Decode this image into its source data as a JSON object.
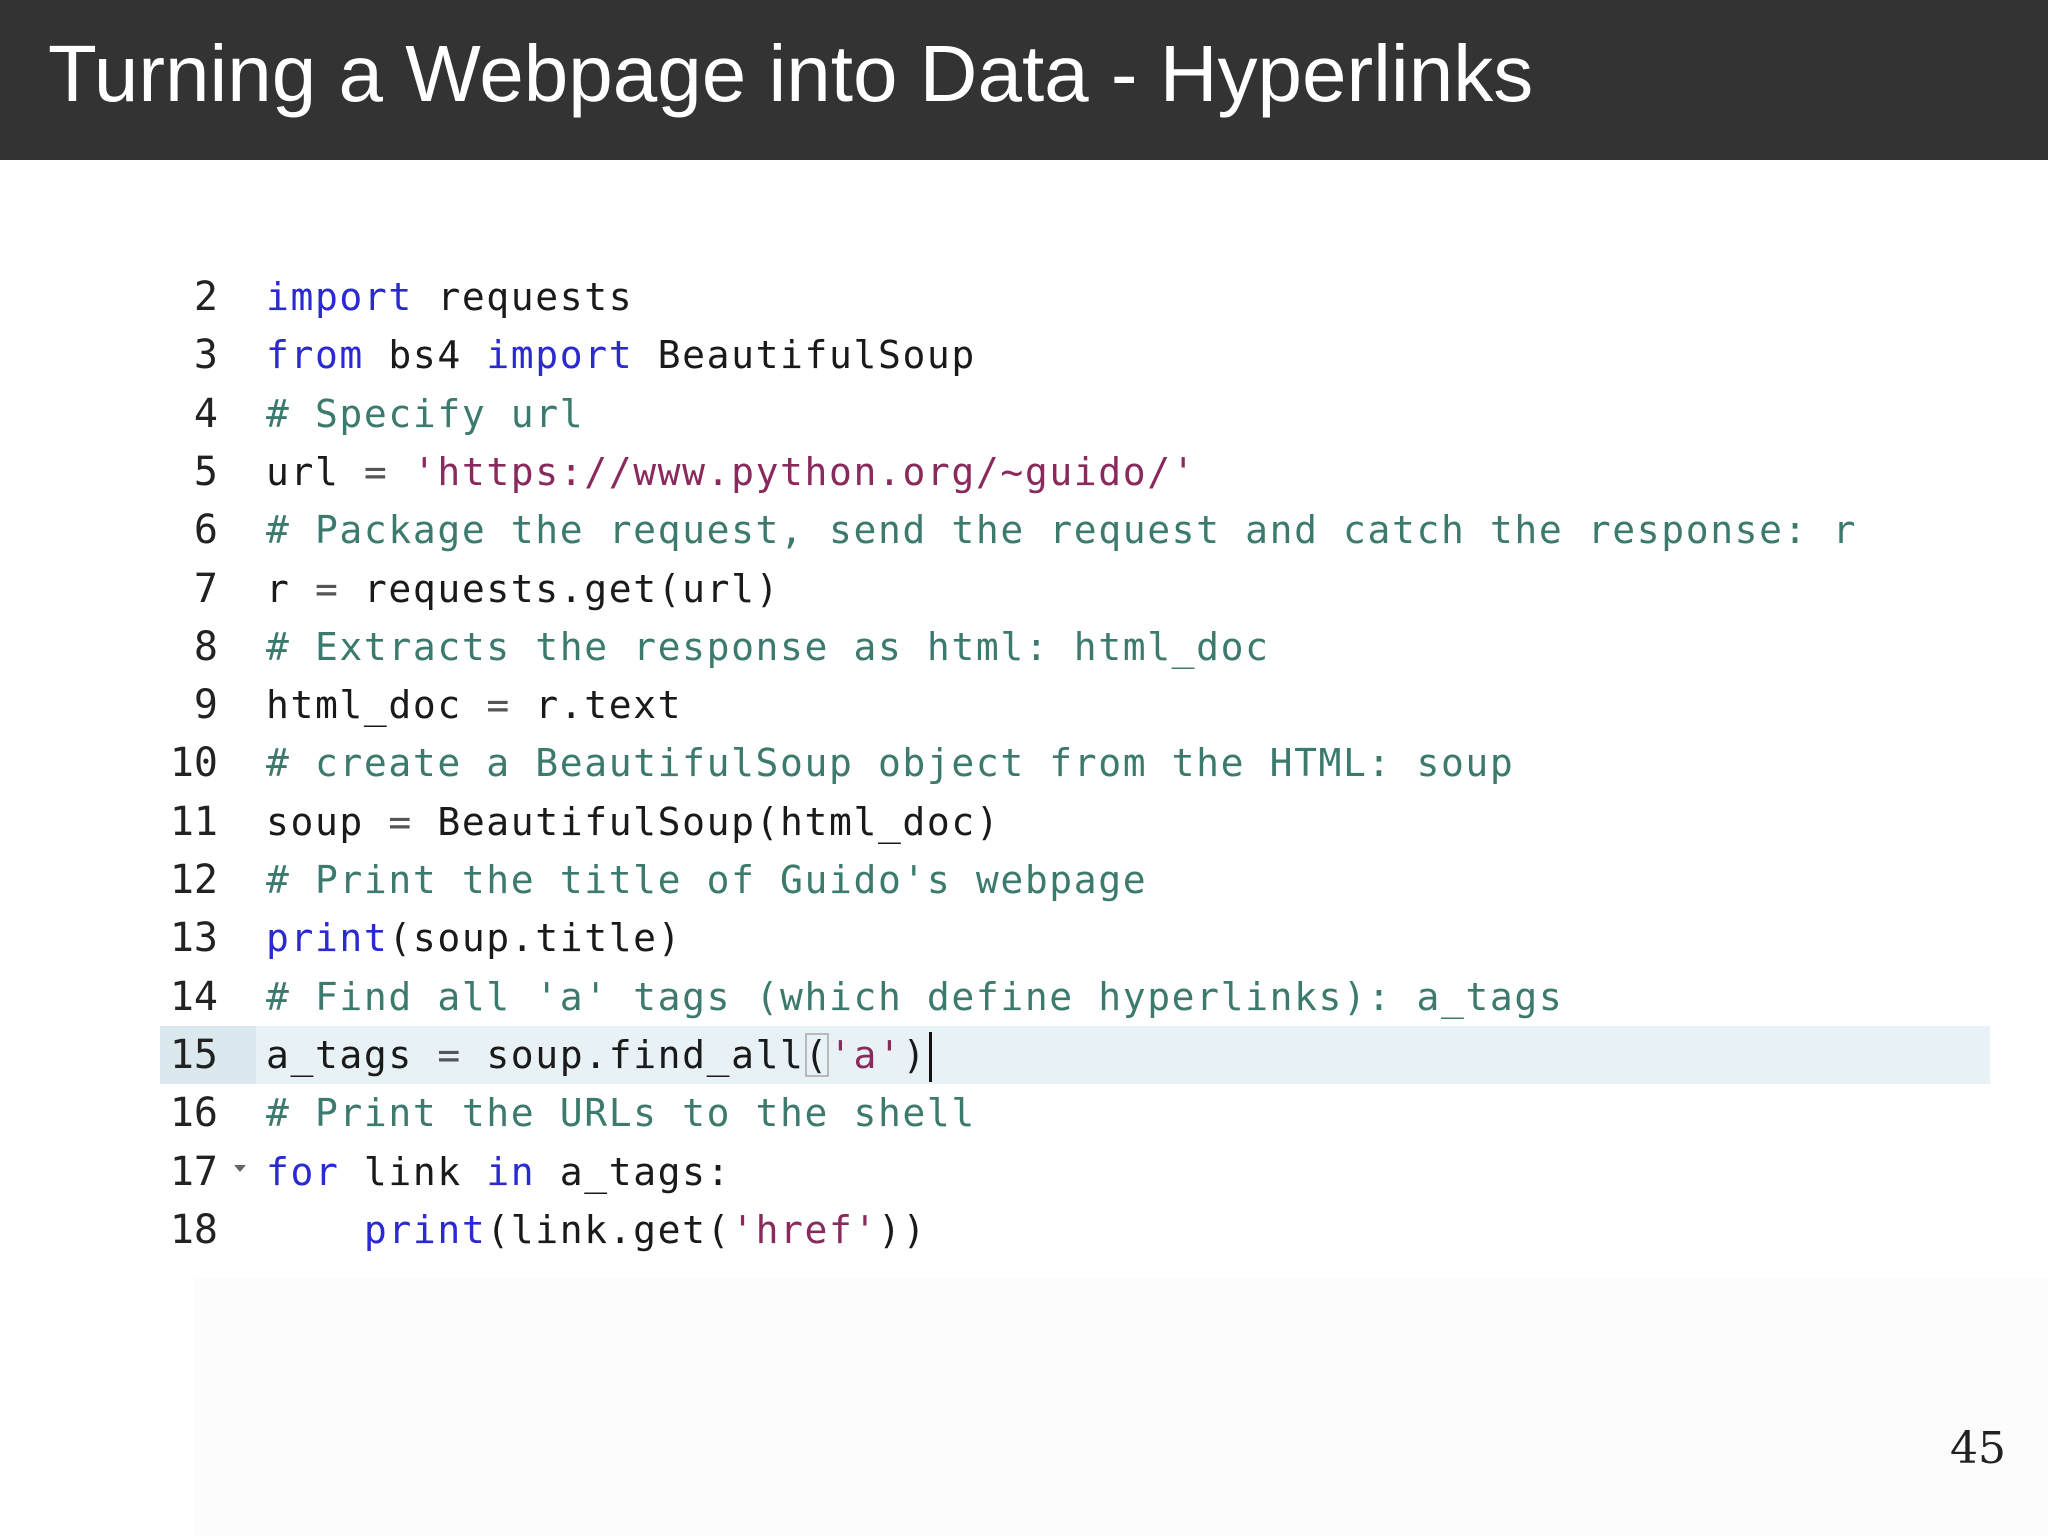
{
  "slide": {
    "title": "Turning a Webpage into Data - Hyperlinks",
    "page_number": "45"
  },
  "editor": {
    "active_line": "15",
    "lines": [
      {
        "no": "2",
        "tokens": [
          [
            "kw",
            "import"
          ],
          [
            "pl",
            " requests"
          ]
        ]
      },
      {
        "no": "3",
        "tokens": [
          [
            "kw",
            "from"
          ],
          [
            "pl",
            " bs4 "
          ],
          [
            "kw",
            "import"
          ],
          [
            "pl",
            " BeautifulSoup"
          ]
        ]
      },
      {
        "no": "4",
        "tokens": [
          [
            "cm",
            "# Specify url"
          ]
        ]
      },
      {
        "no": "5",
        "tokens": [
          [
            "pl",
            "url "
          ],
          [
            "op",
            "="
          ],
          [
            "pl",
            " "
          ],
          [
            "st",
            "'https://www.python.org/~guido/'"
          ]
        ]
      },
      {
        "no": "6",
        "tokens": [
          [
            "cm",
            "# Package the request, send the request and catch the response: r"
          ]
        ]
      },
      {
        "no": "7",
        "tokens": [
          [
            "pl",
            "r "
          ],
          [
            "op",
            "="
          ],
          [
            "pl",
            " requests.get(url)"
          ]
        ]
      },
      {
        "no": "8",
        "tokens": [
          [
            "cm",
            "# Extracts the response as html: html_doc"
          ]
        ]
      },
      {
        "no": "9",
        "tokens": [
          [
            "pl",
            "html_doc "
          ],
          [
            "op",
            "="
          ],
          [
            "pl",
            " r.text"
          ]
        ]
      },
      {
        "no": "10",
        "tokens": [
          [
            "cm",
            "# create a BeautifulSoup object from the HTML: soup"
          ]
        ]
      },
      {
        "no": "11",
        "tokens": [
          [
            "pl",
            "soup "
          ],
          [
            "op",
            "="
          ],
          [
            "pl",
            " BeautifulSoup(html_doc)"
          ]
        ]
      },
      {
        "no": "12",
        "tokens": [
          [
            "cm",
            "# Print the title of Guido's webpage"
          ]
        ]
      },
      {
        "no": "13",
        "tokens": [
          [
            "kw",
            "print"
          ],
          [
            "pl",
            "(soup.title)"
          ]
        ]
      },
      {
        "no": "14",
        "tokens": [
          [
            "cm",
            "# Find all 'a' tags (which define hyperlinks): a_tags"
          ]
        ]
      },
      {
        "no": "15",
        "tokens": [
          [
            "pl",
            "a_tags "
          ],
          [
            "op",
            "="
          ],
          [
            "pl",
            " soup.find_all"
          ],
          [
            "bm",
            "("
          ],
          [
            "st",
            "'a'"
          ],
          [
            "pl",
            ")"
          ]
        ]
      },
      {
        "no": "16",
        "tokens": [
          [
            "cm",
            "# Print the URLs to the shell"
          ]
        ]
      },
      {
        "no": "17",
        "fold": true,
        "tokens": [
          [
            "kw",
            "for"
          ],
          [
            "pl",
            " link "
          ],
          [
            "kw",
            "in"
          ],
          [
            "pl",
            " a_tags:"
          ]
        ]
      },
      {
        "no": "18",
        "tokens": [
          [
            "pl",
            "    "
          ],
          [
            "kw",
            "print"
          ],
          [
            "pl",
            "(link.get("
          ],
          [
            "st",
            "'href'"
          ],
          [
            "pl",
            "))"
          ]
        ]
      }
    ]
  }
}
